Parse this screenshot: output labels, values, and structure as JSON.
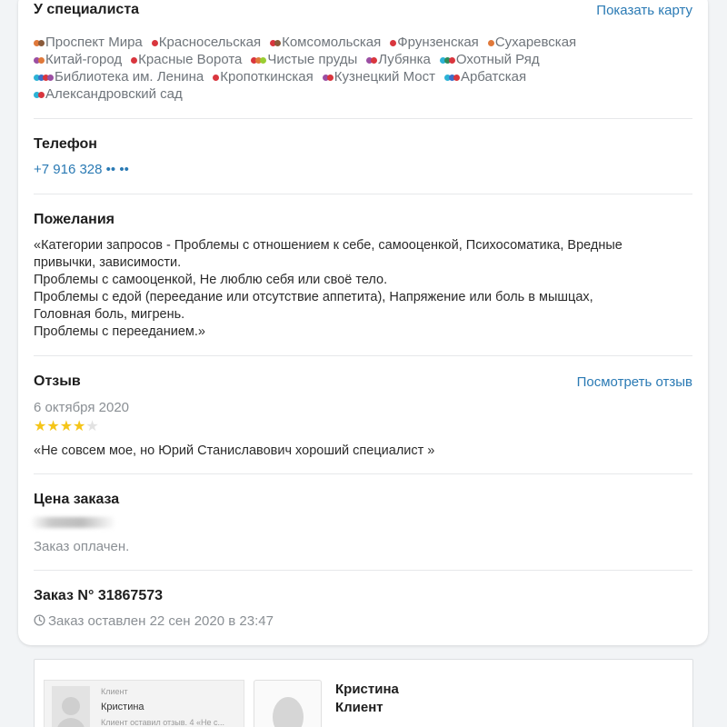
{
  "specialist": {
    "title": "У специалиста",
    "map_link": "Показать карту",
    "metro_rows": [
      [
        {
          "name": "Проспект Мира",
          "colors": [
            "#e0793a",
            "#8a5a3a"
          ]
        },
        {
          "name": "Красносельская",
          "colors": [
            "#d9363e"
          ]
        },
        {
          "name": "Комсомольская",
          "colors": [
            "#d9363e",
            "#8a5a3a"
          ]
        },
        {
          "name": "Фрунзенская",
          "colors": [
            "#d9363e"
          ]
        },
        {
          "name": "Сухаревская",
          "colors": [
            "#e0793a"
          ]
        }
      ],
      [
        {
          "name": "Китай-город",
          "colors": [
            "#9b4fa3",
            "#e0793a"
          ]
        },
        {
          "name": "Красные Ворота",
          "colors": [
            "#d9363e"
          ]
        },
        {
          "name": "Чистые пруды",
          "colors": [
            "#d9363e",
            "#e0793a",
            "#9acd32"
          ]
        },
        {
          "name": "Лубянка",
          "colors": [
            "#9b4fa3",
            "#d9363e"
          ]
        },
        {
          "name": "Охотный Ряд",
          "colors": [
            "#2db3d6",
            "#2e8b57",
            "#d9363e"
          ]
        }
      ],
      [
        {
          "name": "Библиотека им. Ленина",
          "colors": [
            "#2db3d6",
            "#3c6fc9",
            "#d9363e",
            "#9b4fa3"
          ]
        },
        {
          "name": "Кропоткинская",
          "colors": [
            "#d9363e"
          ]
        },
        {
          "name": "Кузнецкий Мост",
          "colors": [
            "#9b4fa3",
            "#d9363e"
          ]
        },
        {
          "name": "Арбатская",
          "colors": [
            "#2db3d6",
            "#3c6fc9",
            "#d9363e"
          ]
        }
      ],
      [
        {
          "name": "Александровский сад",
          "colors": [
            "#2db3d6",
            "#d9363e"
          ]
        }
      ]
    ]
  },
  "phone": {
    "title": "Телефон",
    "value": "+7 916 328 •• ••"
  },
  "wishes": {
    "title": "Пожелания",
    "lines": [
      "«Категории запросов - Проблемы с отношением к себе, самооценкой, Психосоматика, Вредные",
      "привычки, зависимости.",
      "Проблемы с самооценкой, Не люблю себя или своё тело.",
      "Проблемы с едой (переедание или отсутствие аппетита), Напряжение или боль в мышцах,",
      "Головная боль, мигрень.",
      "Проблемы с перееданием.»"
    ]
  },
  "review": {
    "title": "Отзыв",
    "link": "Посмотреть отзыв",
    "date": "6 октября 2020",
    "rating": 4,
    "max_rating": 5,
    "text": "«Не совсем мое, но Юрий Станиславович хороший специалист »",
    "star_color": "#f5c518",
    "star_empty_color": "#e2e2e2"
  },
  "price": {
    "title": "Цена заказа",
    "status": "Заказ оплачен."
  },
  "order": {
    "title": "Заказ N° 31867573",
    "created": "Заказ оставлен 22 сен 2020 в 23:47",
    "icon": "clock-icon"
  },
  "client_card": {
    "thumb_role": "Клиент",
    "thumb_name": "Кристина",
    "thumb_snippet": "Клиент оставил отзыв. 4  «Не с...",
    "name": "Кристина",
    "role": "Клиент"
  },
  "colors": {
    "link": "#2a7ab4",
    "muted": "#8a8f94"
  }
}
